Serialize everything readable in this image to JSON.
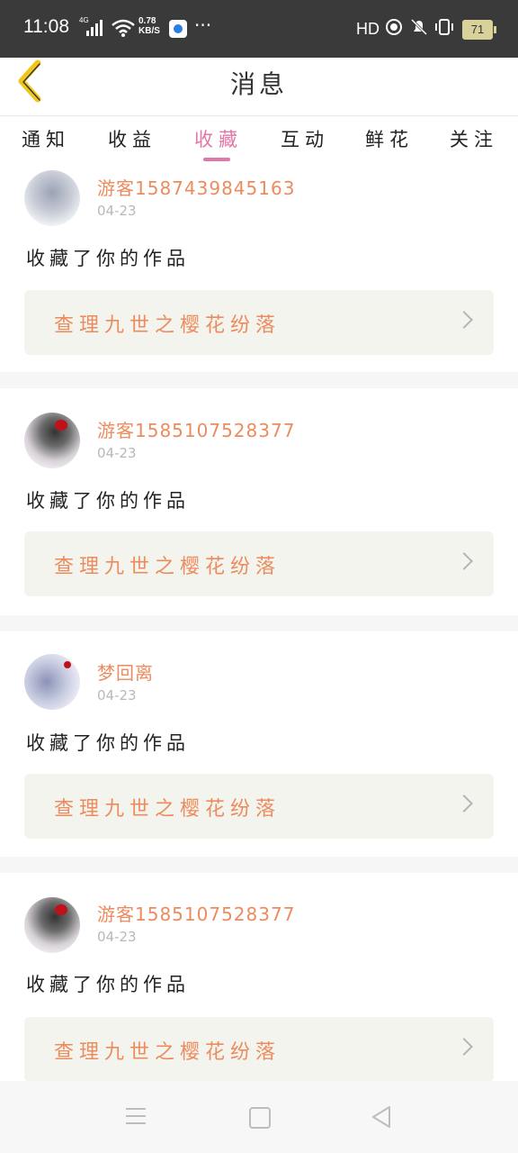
{
  "status_bar": {
    "time": "11:08",
    "network": "4G",
    "speed_value": "0.78",
    "speed_unit": "KB/S",
    "more": "···",
    "hd": "HD",
    "battery": "71"
  },
  "header": {
    "title": "消息"
  },
  "tabs": [
    {
      "label": "通知"
    },
    {
      "label": "收益"
    },
    {
      "label": "收藏"
    },
    {
      "label": "互动"
    },
    {
      "label": "鲜花"
    },
    {
      "label": "关注"
    }
  ],
  "active_tab": "收藏",
  "messages": [
    {
      "username": "游客15874398451​63",
      "date": "04-23",
      "action": "收藏了你的作品",
      "work_title": "查理九世之樱花纷落"
    },
    {
      "username": "游客15851075283​77",
      "date": "04-23",
      "action": "收藏了你的作品",
      "work_title": "查理九世之樱花纷落"
    },
    {
      "username": "梦回离",
      "date": "04-23",
      "action": "收藏了你的作品",
      "work_title": "查理九世之樱花纷落"
    },
    {
      "username": "游客15851075283​77",
      "date": "04-23",
      "action": "收藏了你的作品",
      "work_title": "查理九世之樱花纷落"
    }
  ],
  "colors": {
    "accent_pink": "#e277a8",
    "username_orange": "#ec8c5e",
    "back_arrow_yellow": "#f0c61a",
    "card_bg": "#f4f4ee"
  },
  "icons": {
    "back": "chevron-left-icon",
    "work_arrow": "chevron-right-icon",
    "nav_menu": "menu-icon",
    "nav_home": "square-home-icon",
    "nav_back": "triangle-back-icon"
  }
}
